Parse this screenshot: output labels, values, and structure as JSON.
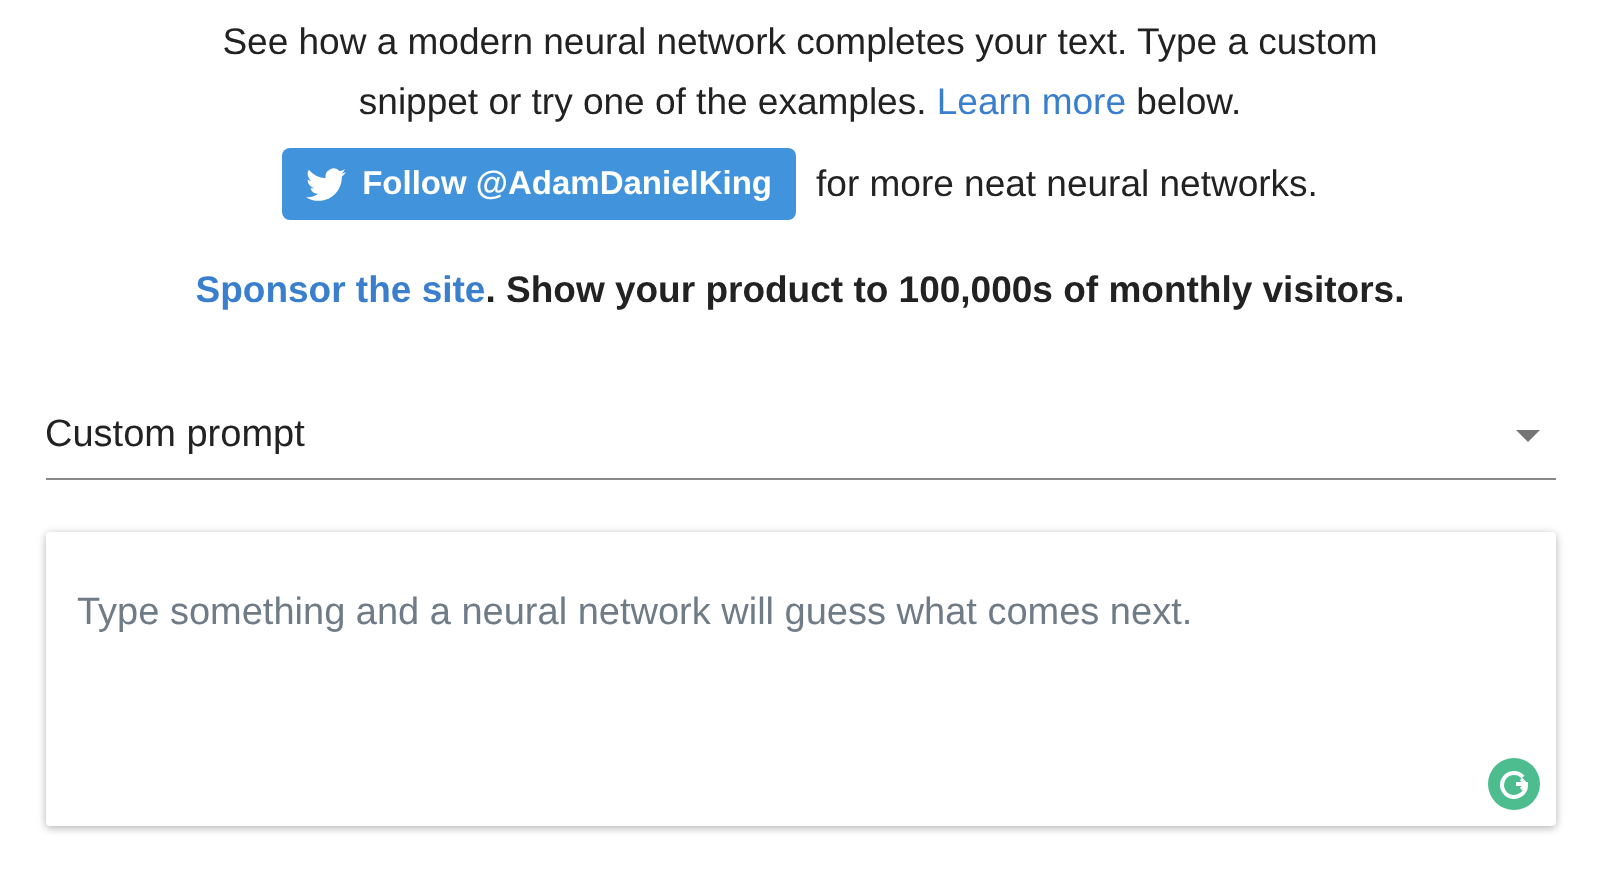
{
  "intro": {
    "text_before": "See how a modern neural network completes your text. Type a custom snippet or try one of the examples.",
    "link": "Learn more",
    "text_after": "below."
  },
  "follow": {
    "button": "Follow @AdamDanielKing",
    "text": "for more neat neural networks."
  },
  "sponsor": {
    "link": "Sponsor the site",
    "text": ". Show your product to 100,000s of monthly visitors."
  },
  "prompt_select": {
    "value": "Custom prompt"
  },
  "editor": {
    "placeholder": "Type something and a neural network will guess what comes next."
  }
}
